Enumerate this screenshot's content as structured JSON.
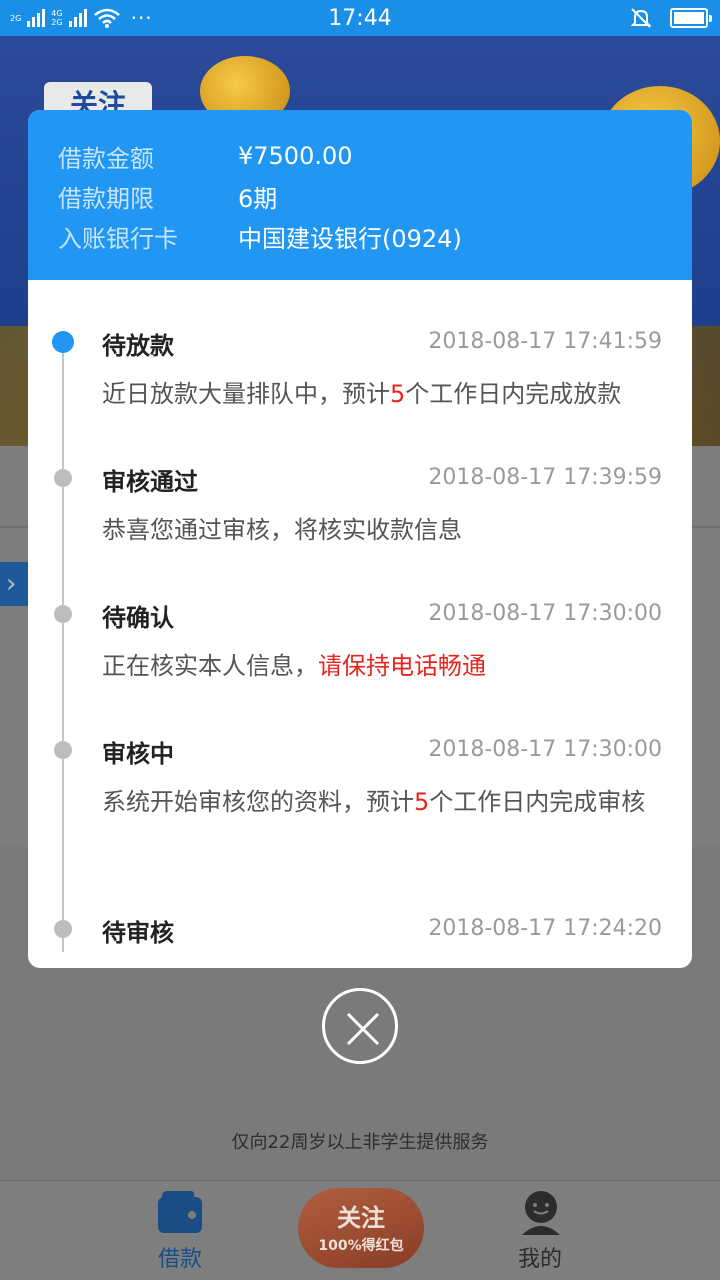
{
  "status_bar": {
    "time": "17:44",
    "net1": "2G",
    "net2": "4G",
    "net3": "2G",
    "dots": "···"
  },
  "background": {
    "banner_tag": "关注",
    "footnote": "仅向22周岁以上非学生提供服务"
  },
  "modal": {
    "rows": [
      {
        "label": "借款金额",
        "value": "¥7500.00"
      },
      {
        "label": "借款期限",
        "value": "6期"
      },
      {
        "label": "入账银行卡",
        "value": "中国建设银行(0924)"
      }
    ],
    "entries": [
      {
        "title": "待放款",
        "time": "2018-08-17 17:41:59",
        "desc_a": "近日放款大量排队中，预计",
        "desc_hl": "5",
        "desc_b": "个工作日内完成放款"
      },
      {
        "title": "审核通过",
        "time": "2018-08-17 17:39:59",
        "desc_a": "恭喜您通过审核，将核实收款信息",
        "desc_hl": "",
        "desc_b": ""
      },
      {
        "title": "待确认",
        "time": "2018-08-17 17:30:00",
        "desc_a": "正在核实本人信息，",
        "desc_hl": "请保持电话畅通",
        "desc_b": ""
      },
      {
        "title": "审核中",
        "time": "2018-08-17 17:30:00",
        "desc_a": "系统开始审核您的资料，预计",
        "desc_hl": "5",
        "desc_b": "个工作日内完成审核"
      },
      {
        "title": "待审核",
        "time": "2018-08-17 17:24:20",
        "desc_a": "",
        "desc_hl": "",
        "desc_b": ""
      }
    ]
  },
  "tabbar": {
    "loan": "借款",
    "mine": "我的",
    "promo_line1": "关注",
    "promo_line2": "100%得红包"
  },
  "colors": {
    "accent": "#2196f3",
    "highlight": "#e8261d"
  },
  "icons": [
    "signal-icon",
    "wifi-icon",
    "mute-bell-icon",
    "battery-icon",
    "close-icon",
    "wallet-icon",
    "person-icon"
  ]
}
